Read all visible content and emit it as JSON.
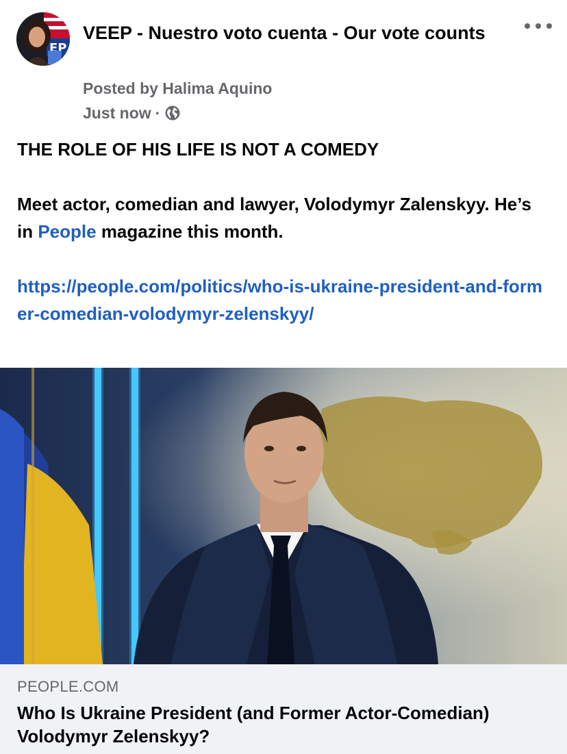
{
  "post": {
    "group_name": "VEEP - Nuestro voto cuenta - Our vote counts",
    "posted_by": "Posted by Halima Aquino",
    "time": "Just now",
    "separator": "·",
    "privacy_icon": "globe-icon",
    "more_icon": "more-options-icon"
  },
  "body": {
    "headline": "THE ROLE OF HIS LIFE IS NOT A COMEDY",
    "paragraph_before_link": "Meet actor, comedian and lawyer, Volodymyr Zalenskyy. He’s in ",
    "inline_link": "People",
    "paragraph_after_link": " magazine this month.",
    "url": "https://people.com/politics/who-is-ukraine-president-and-former-comedian-volodymyr-zelenskyy/"
  },
  "preview": {
    "domain": "PEOPLE.COM",
    "title": "Who Is Ukraine President (and Former Actor-Comedian) Volodymyr Zelenskyy?"
  },
  "colors": {
    "link": "#1f5fc1",
    "secondary_text": "#65676b",
    "caption_bg": "#f0f2f5"
  }
}
